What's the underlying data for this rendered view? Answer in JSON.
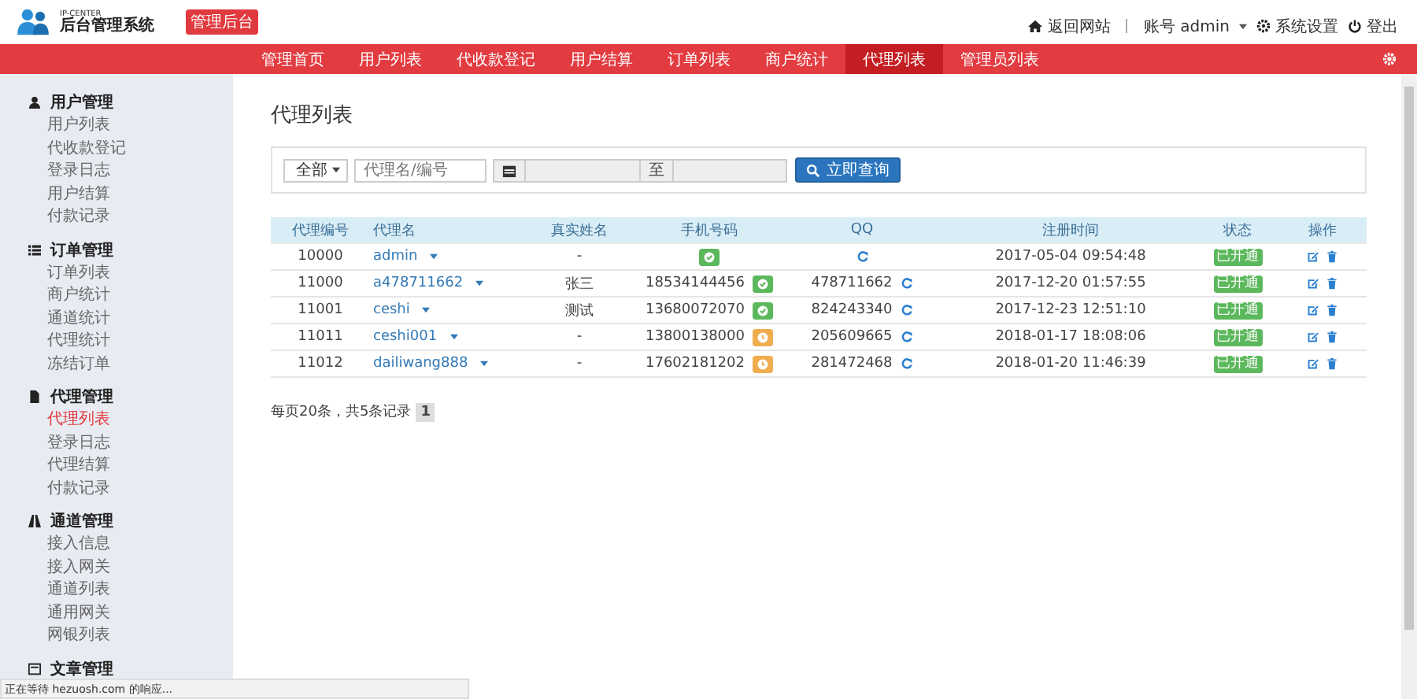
{
  "header": {
    "logo_caption": "IP-CENTER",
    "system_name": "后台管理系统",
    "badge": "管理后台",
    "links": [
      {
        "kind": "home",
        "label": "返回网站"
      },
      {
        "kind": "account",
        "label": "账号 admin"
      },
      {
        "kind": "settings",
        "label": "系统设置"
      },
      {
        "kind": "logout",
        "label": "登出"
      }
    ]
  },
  "nav": [
    {
      "label": "管理首页",
      "selected": false
    },
    {
      "label": "用户列表",
      "selected": false
    },
    {
      "label": "代收款登记",
      "selected": false
    },
    {
      "label": "用户结算",
      "selected": false
    },
    {
      "label": "订单列表",
      "selected": false
    },
    {
      "label": "商户统计",
      "selected": false
    },
    {
      "label": "代理列表",
      "selected": true
    },
    {
      "label": "管理员列表",
      "selected": false
    }
  ],
  "sidebar": [
    {
      "title": "用户管理",
      "kind": "user",
      "items": [
        {
          "label": "用户列表",
          "selected": false
        },
        {
          "label": "代收款登记",
          "selected": false
        },
        {
          "label": "登录日志",
          "selected": false
        },
        {
          "label": "用户结算",
          "selected": false
        },
        {
          "label": "付款记录",
          "selected": false
        }
      ]
    },
    {
      "title": "订单管理",
      "kind": "list",
      "items": [
        {
          "label": "订单列表",
          "selected": false
        },
        {
          "label": "商户统计",
          "selected": false
        },
        {
          "label": "通道统计",
          "selected": false
        },
        {
          "label": "代理统计",
          "selected": false
        },
        {
          "label": "冻结订单",
          "selected": false
        }
      ]
    },
    {
      "title": "代理管理",
      "kind": "file",
      "items": [
        {
          "label": "代理列表",
          "selected": true
        },
        {
          "label": "登录日志",
          "selected": false
        },
        {
          "label": "代理结算",
          "selected": false
        },
        {
          "label": "付款记录",
          "selected": false
        }
      ]
    },
    {
      "title": "通道管理",
      "kind": "road",
      "items": [
        {
          "label": "接入信息",
          "selected": false
        },
        {
          "label": "接入网关",
          "selected": false
        },
        {
          "label": "通道列表",
          "selected": false
        },
        {
          "label": "通用网关",
          "selected": false
        },
        {
          "label": "网银列表",
          "selected": false
        }
      ]
    },
    {
      "title": "文章管理",
      "kind": "article"
    }
  ],
  "page_title": "代理列表",
  "search": {
    "type_select": "全部",
    "keyword_placeholder": "代理名/编号",
    "range_separator": "至",
    "button": "立即查询"
  },
  "table": {
    "columns": [
      "代理编号",
      "代理名",
      "真实姓名",
      "手机号码",
      "QQ",
      "注册时间",
      "状态",
      "操作"
    ],
    "rows": [
      {
        "id": "10000",
        "name": "admin",
        "real_name": "-",
        "phone": "",
        "phone_verified": true,
        "qq": "",
        "registered": "2017-05-04 09:54:48",
        "status": "已开通"
      },
      {
        "id": "11000",
        "name": "a478711662",
        "real_name": "张三",
        "phone": "18534144456",
        "phone_verified": true,
        "qq": "478711662",
        "registered": "2017-12-20 01:57:55",
        "status": "已开通"
      },
      {
        "id": "11001",
        "name": "ceshi",
        "real_name": "测试",
        "phone": "13680072070",
        "phone_verified": true,
        "qq": "824243340",
        "registered": "2017-12-23 12:51:10",
        "status": "已开通"
      },
      {
        "id": "11011",
        "name": "ceshi001",
        "real_name": "-",
        "phone": "13800138000",
        "phone_verified": false,
        "qq": "205609665",
        "registered": "2018-01-17 18:08:06",
        "status": "已开通"
      },
      {
        "id": "11012",
        "name": "dailiwang888",
        "real_name": "-",
        "phone": "17602181202",
        "phone_verified": false,
        "qq": "281472468",
        "registered": "2018-01-20 11:46:39",
        "status": "已开通"
      }
    ]
  },
  "pagination": {
    "summary": "每页20条，共5条记录",
    "pages": [
      {
        "label": "1",
        "selected": true
      }
    ]
  },
  "status_bar": "正在等待 hezuosh.com 的响应..."
}
